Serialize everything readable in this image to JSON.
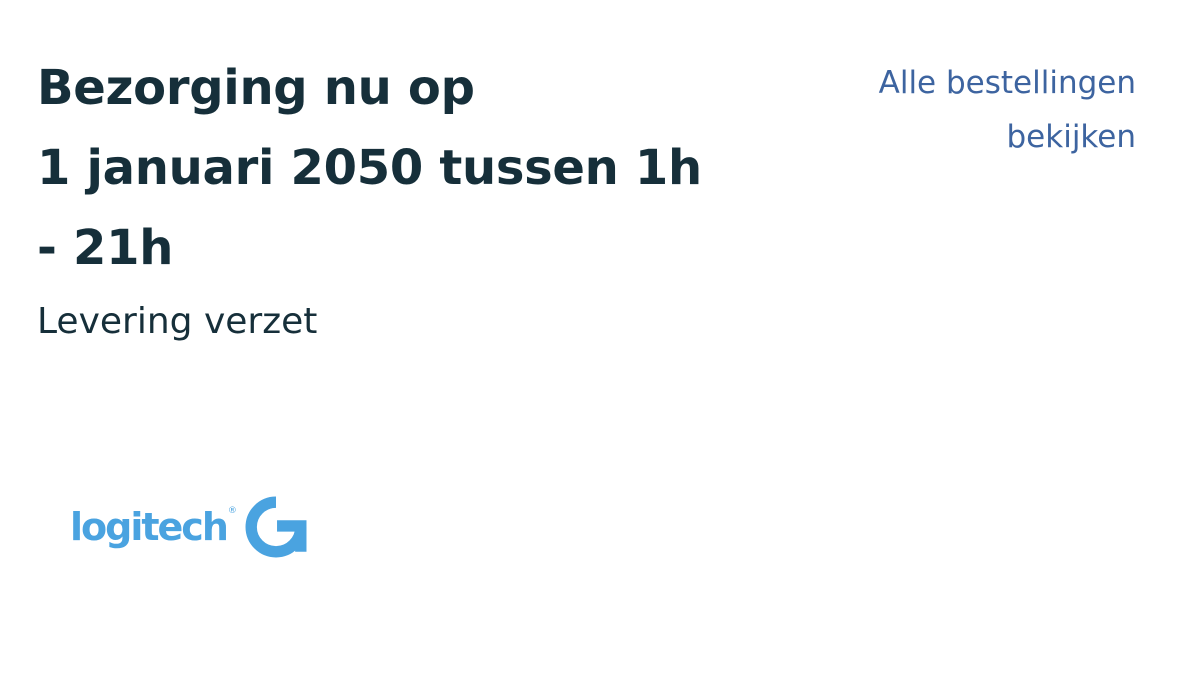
{
  "delivery": {
    "headline_lines": [
      "Bezorging nu op",
      "1 januari 2050 tussen 1h",
      "- 21h"
    ],
    "status": "Levering verzet"
  },
  "orders_link": {
    "lines": [
      "Alle bestellingen",
      "bekijken"
    ]
  },
  "brand": {
    "wordmark": "logitech",
    "registered_mark": "®",
    "icon": "logitech-g-icon",
    "color": "#4aa3e0"
  },
  "colors": {
    "text": "#162f3a",
    "link": "#3d64a0",
    "background": "#ffffff"
  }
}
